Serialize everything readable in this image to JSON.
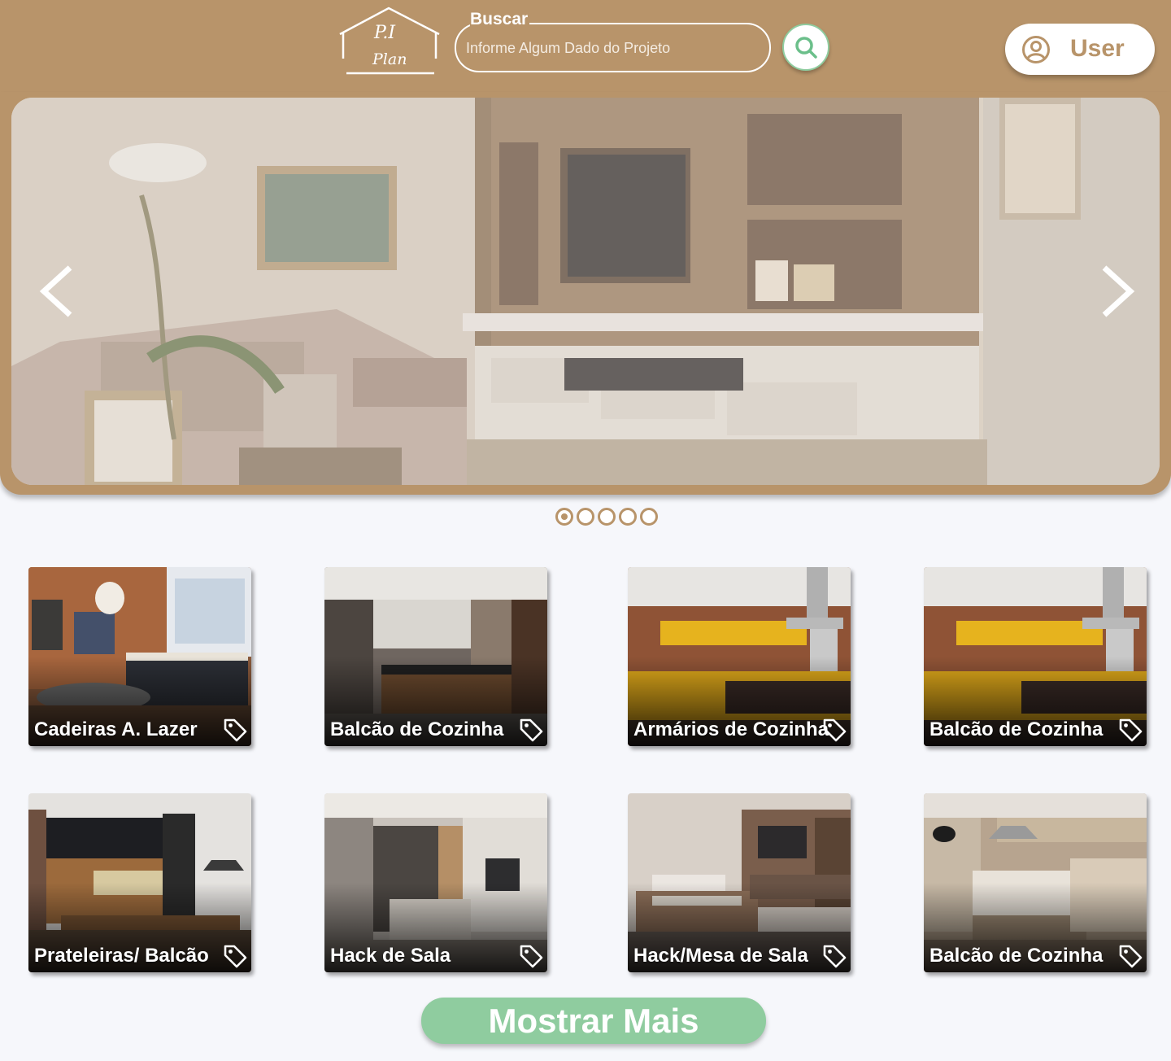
{
  "header": {
    "logo": {
      "line1": "P.I",
      "line2": "Plan"
    },
    "search": {
      "label": "Buscar",
      "placeholder": "Informe Algum Dado do Projeto",
      "value": ""
    },
    "user_label": "User"
  },
  "carousel": {
    "slide_count": 5,
    "active_index": 0
  },
  "cards": [
    {
      "title": "Cadeiras A. Lazer"
    },
    {
      "title": "Balcão de Cozinha"
    },
    {
      "title": "Armários de Cozinha"
    },
    {
      "title": "Balcão de Cozinha"
    },
    {
      "title": "Prateleiras/ Balcão"
    },
    {
      "title": "Hack de Sala"
    },
    {
      "title": "Hack/Mesa de Sala"
    },
    {
      "title": "Balcão de Cozinha"
    }
  ],
  "more_button": "Mostrar Mais",
  "colors": {
    "brand": "#b8946a",
    "accent": "#8fcc9f",
    "background": "#f6f7fb"
  }
}
